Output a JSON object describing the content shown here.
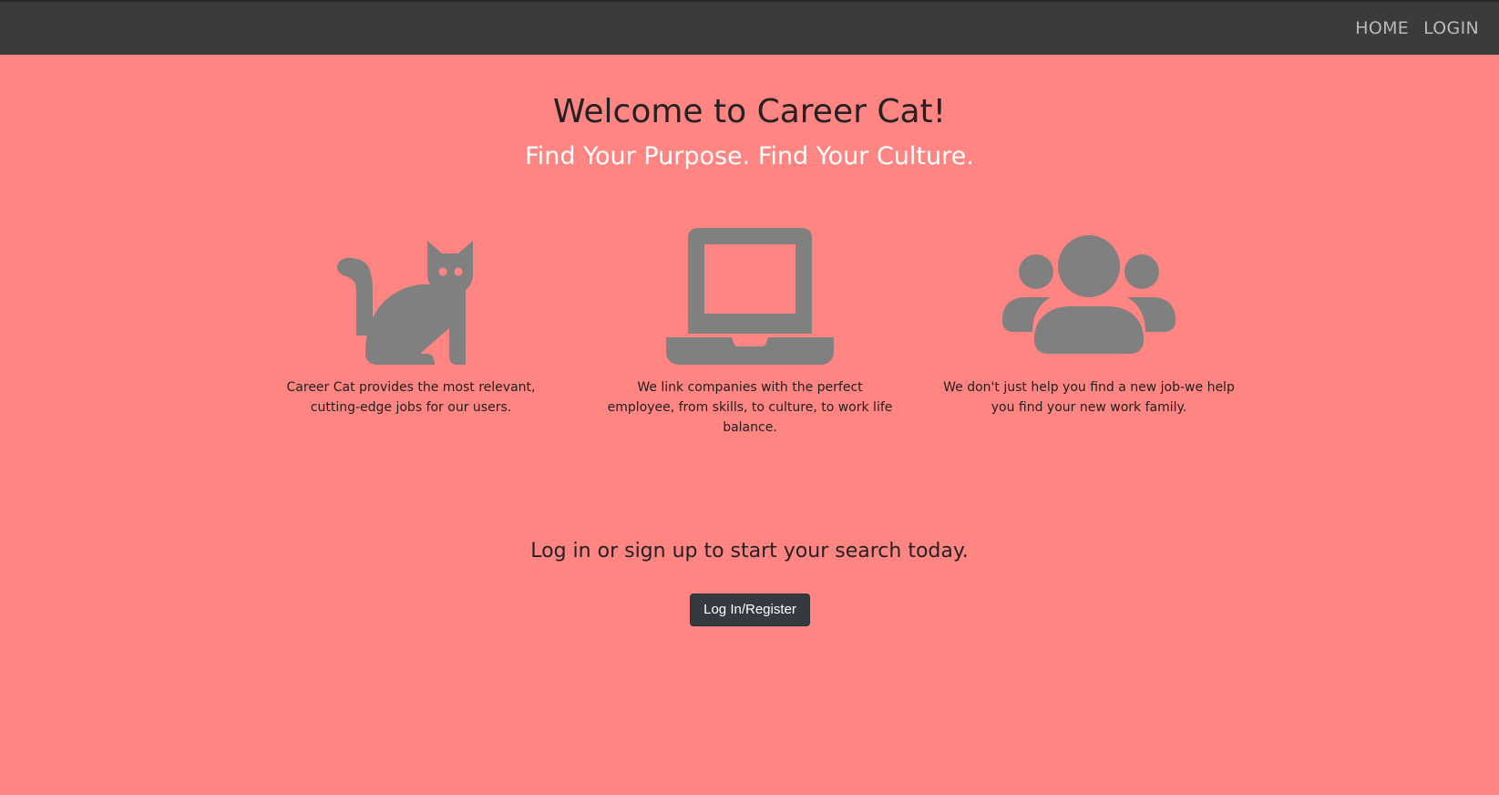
{
  "nav": {
    "links": [
      {
        "label": "HOME"
      },
      {
        "label": "LOGIN"
      }
    ]
  },
  "hero": {
    "title": "Welcome to Career Cat!",
    "subtitle": "Find Your Purpose. Find Your Culture."
  },
  "features": [
    {
      "icon": "cat-icon",
      "text": "Career Cat provides the most relevant, cutting-edge jobs for our users."
    },
    {
      "icon": "laptop-icon",
      "text": "We link companies with the perfect employee, from skills, to culture, to work life balance."
    },
    {
      "icon": "users-icon",
      "text": "We don't just help you find a new job-we help you find your new work family."
    }
  ],
  "cta": {
    "text": "Log in or sign up to start your search today.",
    "button_label": "Log In/Register"
  },
  "colors": {
    "page_background": "#ff8582",
    "navbar_background": "#3b3b3b",
    "nav_link": "#b9b9b9",
    "icon_gray": "#808080",
    "button_background": "#343a40"
  }
}
